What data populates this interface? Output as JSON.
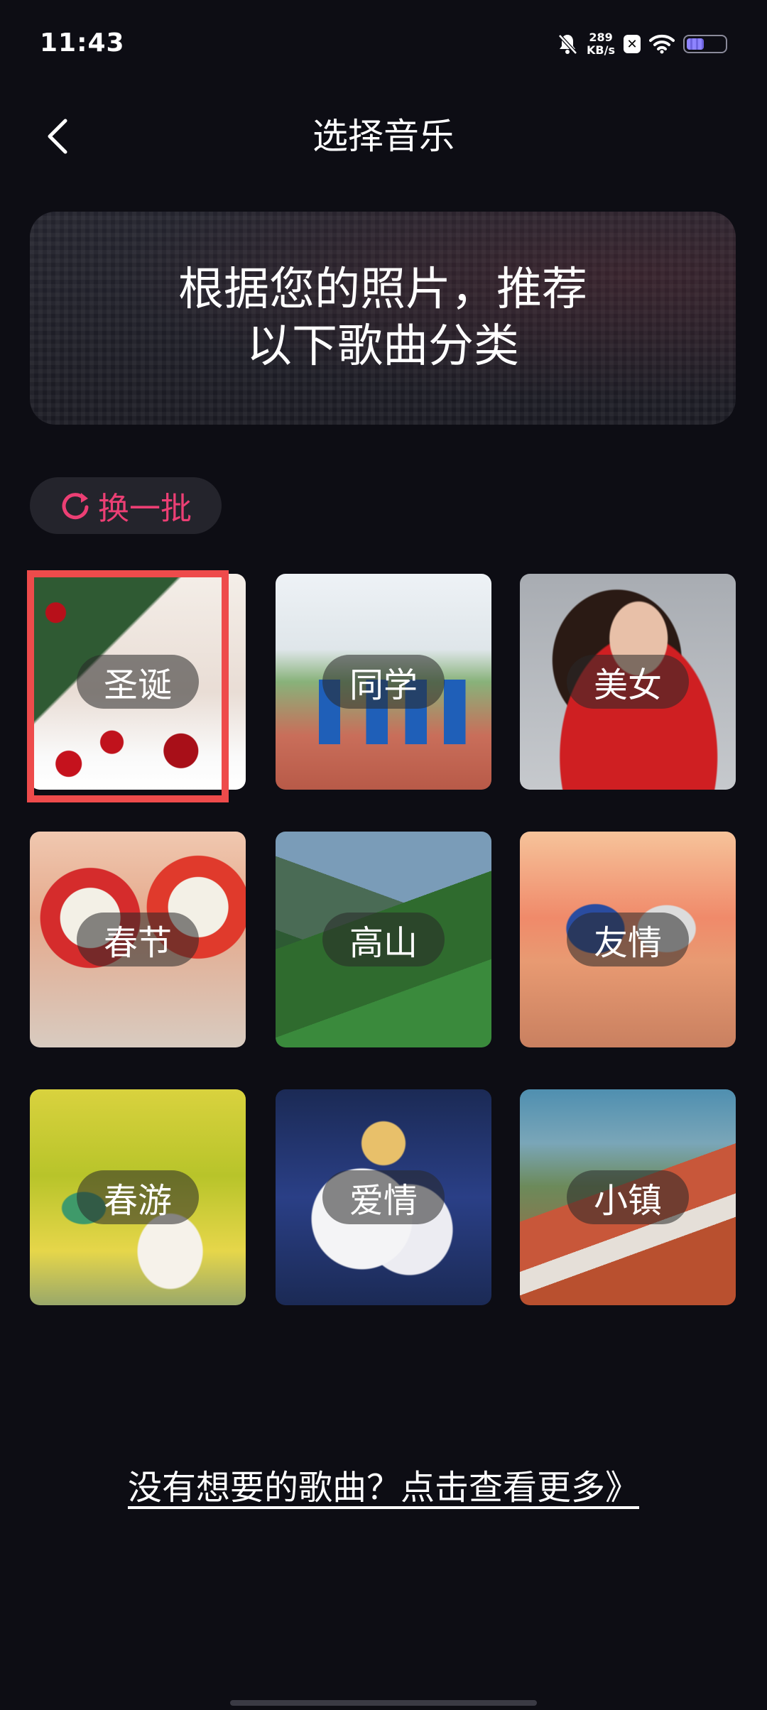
{
  "status_bar": {
    "time": "11:43",
    "speed_value": "289",
    "speed_unit": "KB/s",
    "icons": [
      "bell-mute-icon",
      "x-app-icon",
      "wifi-icon",
      "battery-icon"
    ]
  },
  "header": {
    "title": "选择音乐",
    "back_icon": "chevron-left-icon"
  },
  "banner": {
    "line1": "根据您的照片，推荐",
    "line2": "以下歌曲分类"
  },
  "refresh": {
    "label": "换一批",
    "icon": "refresh-icon",
    "color": "#ec3f74"
  },
  "categories": [
    {
      "label": "圣诞",
      "selected": true
    },
    {
      "label": "同学",
      "selected": false
    },
    {
      "label": "美女",
      "selected": false
    },
    {
      "label": "春节",
      "selected": false
    },
    {
      "label": "高山",
      "selected": false
    },
    {
      "label": "友情",
      "selected": false
    },
    {
      "label": "春游",
      "selected": false
    },
    {
      "label": "爱情",
      "selected": false
    },
    {
      "label": "小镇",
      "selected": false
    }
  ],
  "footer": {
    "more_link": "没有想要的歌曲？点击查看更多》"
  },
  "colors": {
    "background": "#0d0d14",
    "accent": "#ec3f74",
    "selection": "#ee4b4b"
  }
}
